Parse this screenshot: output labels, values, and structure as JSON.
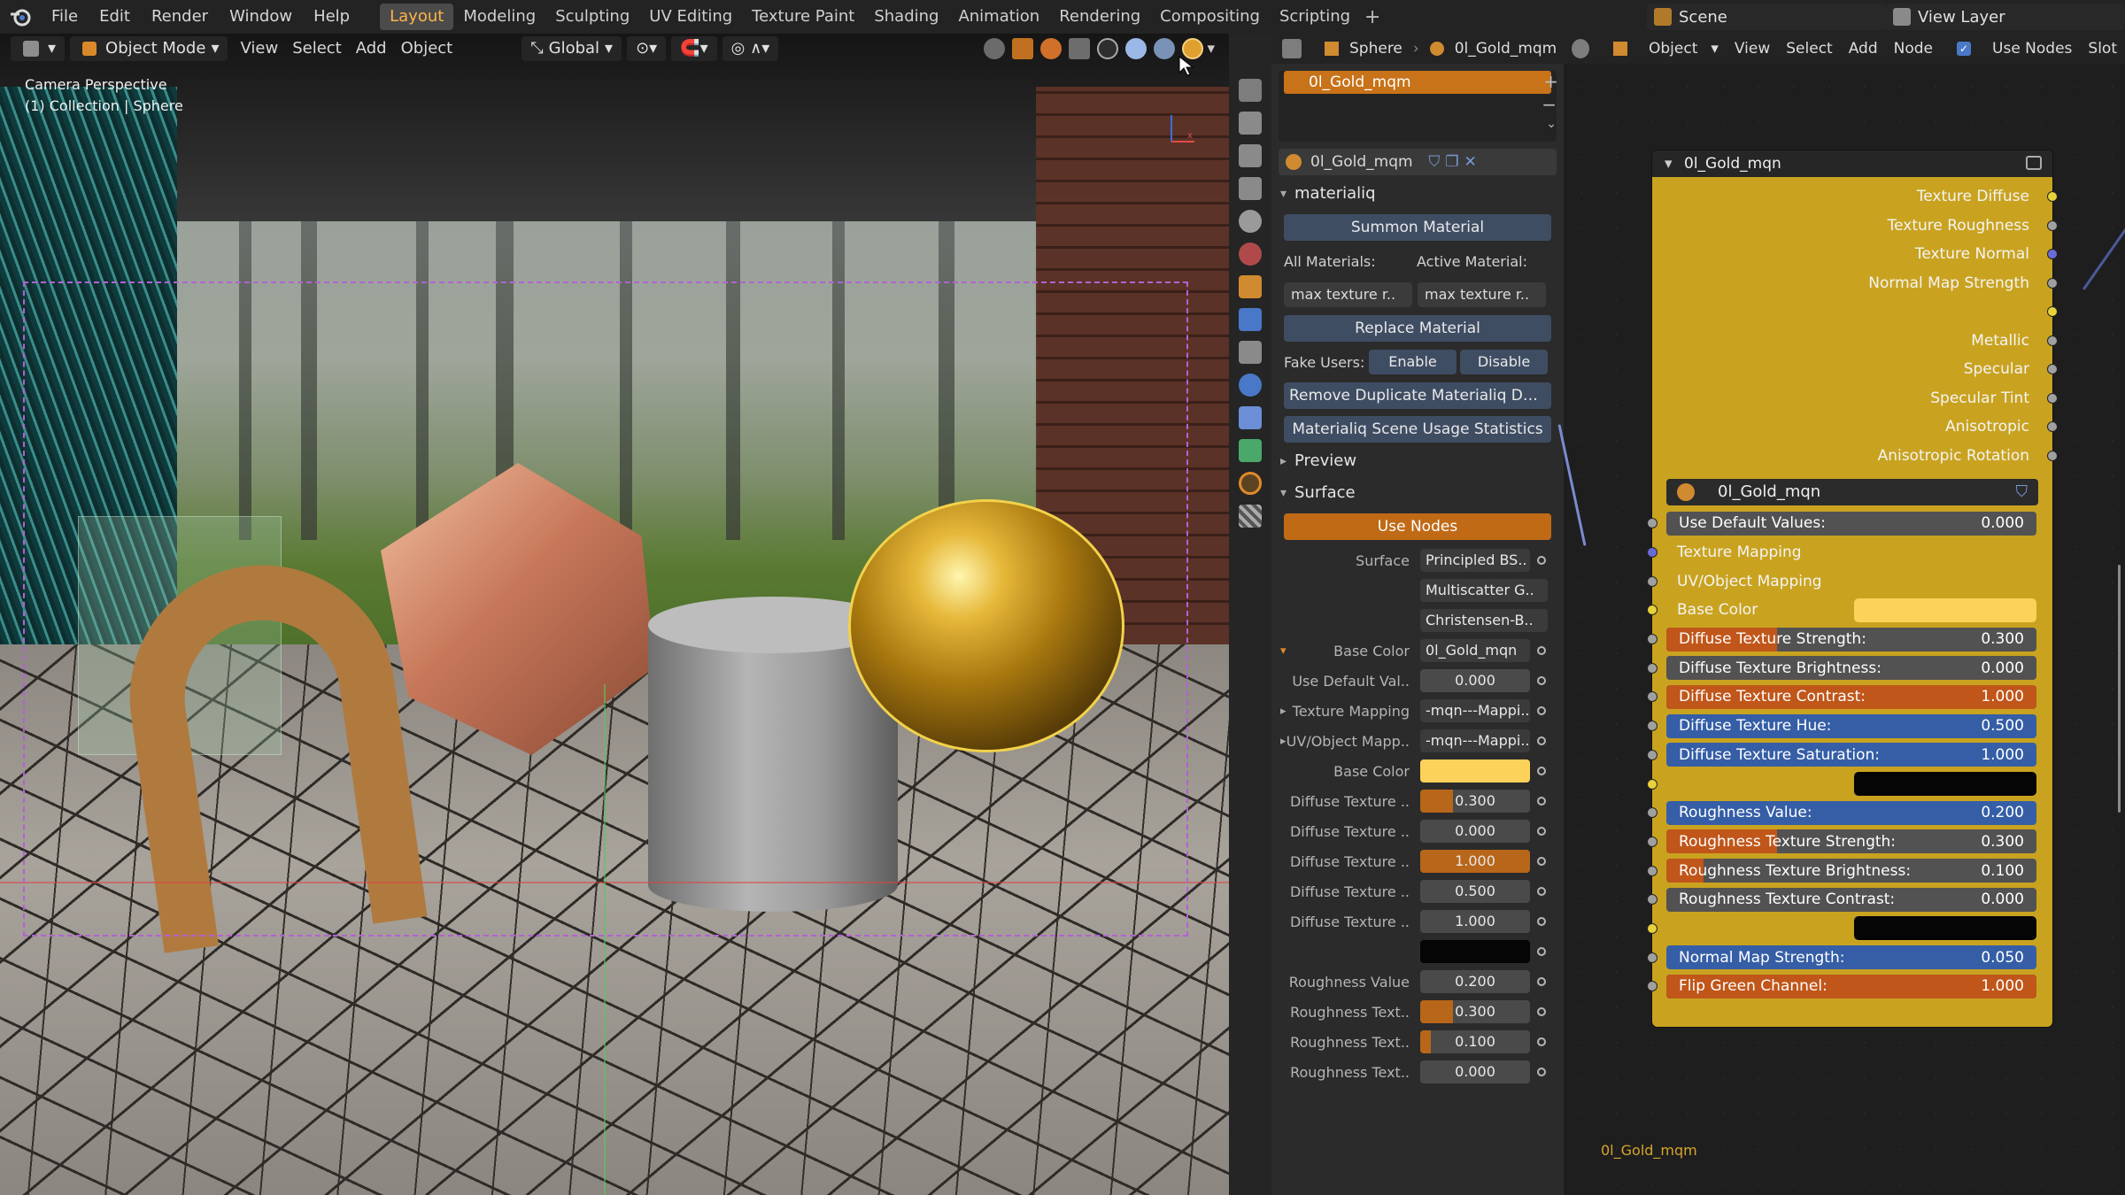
{
  "menubar": {
    "items": [
      "File",
      "Edit",
      "Render",
      "Window",
      "Help"
    ],
    "workspaces": [
      "Layout",
      "Modeling",
      "Sculpting",
      "UV Editing",
      "Texture Paint",
      "Shading",
      "Animation",
      "Rendering",
      "Compositing",
      "Scripting"
    ],
    "active_workspace": "Layout",
    "add_workspace": "+",
    "scene": "Scene",
    "view_layer": "View Layer"
  },
  "viewport": {
    "mode": "Object Mode",
    "menus": [
      "View",
      "Select",
      "Add",
      "Object"
    ],
    "transform_orientation": "Global",
    "camera_label": "Camera Perspective",
    "collection_label": "(1) Collection | Sphere"
  },
  "properties": {
    "object_name": "Sphere",
    "material_name": "0l_Gold_mqm",
    "slot_name": "0l_Gold_mqm",
    "material_field": "0l_Gold_mqm",
    "addon_section": "materialiq",
    "summon_button": "Summon Material",
    "all_materials_label": "All Materials:",
    "active_material_label": "Active Material:",
    "all_materials_value": "max texture r..",
    "active_material_value": "max texture r..",
    "replace_button": "Replace Material",
    "fake_users_label": "Fake Users:",
    "enable_button": "Enable",
    "disable_button": "Disable",
    "remove_dup_button": "Remove Duplicate Materialiq Data-..",
    "stats_button": "Materialiq Scene Usage Statistics",
    "preview_section": "Preview",
    "surface_section": "Surface",
    "use_nodes_button": "Use Nodes",
    "surface_label": "Surface",
    "surface_value": "Principled BS..",
    "subsurface_method": "Multiscatter G..",
    "distribution": "Christensen-B..",
    "fields": [
      {
        "label": "Base Color",
        "value": "0l_Gold_mqn",
        "kind": "link",
        "expander": "open"
      },
      {
        "label": "Use Default Val..",
        "value": "0.000",
        "kind": "plain"
      },
      {
        "label": "Texture Mapping",
        "value": "-mqn---Mappi..",
        "kind": "link",
        "expander": "closed"
      },
      {
        "label": "UV/Object Mapp..",
        "value": "-mqn---Mappi..",
        "kind": "link",
        "expander": "closed"
      },
      {
        "label": "Base Color",
        "value": "",
        "kind": "color",
        "color": "#fcd25a"
      },
      {
        "label": "Diffuse Texture ..",
        "value": "0.300",
        "kind": "slider",
        "fill": 0.3
      },
      {
        "label": "Diffuse Texture ..",
        "value": "0.000",
        "kind": "slider",
        "fill": 0.0
      },
      {
        "label": "Diffuse Texture ..",
        "value": "1.000",
        "kind": "slider",
        "fill": 1.0
      },
      {
        "label": "Diffuse Texture ..",
        "value": "0.500",
        "kind": "plain"
      },
      {
        "label": "Diffuse Texture ..",
        "value": "1.000",
        "kind": "plain"
      },
      {
        "label": "",
        "value": "",
        "kind": "black"
      },
      {
        "label": "Roughness Value",
        "value": "0.200",
        "kind": "plain"
      },
      {
        "label": "Roughness Text..",
        "value": "0.300",
        "kind": "slider",
        "fill": 0.3
      },
      {
        "label": "Roughness Text..",
        "value": "0.100",
        "kind": "slider",
        "fill": 0.1
      },
      {
        "label": "Roughness Text..",
        "value": "0.000",
        "kind": "slider",
        "fill": 0.0
      }
    ]
  },
  "node_editor": {
    "mode": "Object",
    "menus": [
      "View",
      "Select",
      "Add",
      "Node"
    ],
    "use_nodes_label": "Use Nodes",
    "slot_label": "Slot",
    "node_title": "0l_Gold_mqn",
    "node_group": "0l_Gold_mqn",
    "footer_label": "0l_Gold_mqm",
    "outputs": [
      {
        "label": "Texture Diffuse",
        "color": "#e8d23a"
      },
      {
        "label": "Texture Roughness",
        "color": "#a0a0a0"
      },
      {
        "label": "Texture Normal",
        "color": "#6b6bd8"
      },
      {
        "label": "Normal Map Strength",
        "color": "#a0a0a0"
      },
      {
        "label": "",
        "color": "#e8d23a"
      },
      {
        "label": "Metallic",
        "color": "#a0a0a0"
      },
      {
        "label": "Specular",
        "color": "#a0a0a0"
      },
      {
        "label": "Specular Tint",
        "color": "#a0a0a0"
      },
      {
        "label": "Anisotropic",
        "color": "#a0a0a0"
      },
      {
        "label": "Anisotropic Rotation",
        "color": "#a0a0a0"
      }
    ],
    "inputs": [
      {
        "label": "Use Default Values:",
        "value": "0.000",
        "kind": "field",
        "fill": 0,
        "sock": "#a0a0a0"
      },
      {
        "label": "Texture Mapping",
        "value": "",
        "kind": "plain",
        "sock": "#6b6bd8"
      },
      {
        "label": "UV/Object Mapping",
        "value": "",
        "kind": "plain",
        "sock": "#a0a0a0"
      },
      {
        "label": "Base Color",
        "value": "",
        "kind": "color",
        "color": "#fcd25a",
        "sock": "#e8d23a"
      },
      {
        "label": "Diffuse Texture Strength:",
        "value": "0.300",
        "kind": "field",
        "fill": 0.3,
        "sock": "#a0a0a0"
      },
      {
        "label": "Diffuse Texture Brightness:",
        "value": "0.000",
        "kind": "field",
        "fill": 0,
        "sock": "#a0a0a0"
      },
      {
        "label": "Diffuse Texture Contrast:",
        "value": "1.000",
        "kind": "field",
        "fill": 1,
        "sock": "#a0a0a0"
      },
      {
        "label": "Diffuse Texture Hue:",
        "value": "0.500",
        "kind": "blue",
        "sock": "#a0a0a0"
      },
      {
        "label": "Diffuse Texture Saturation:",
        "value": "1.000",
        "kind": "blue",
        "sock": "#a0a0a0"
      },
      {
        "label": "",
        "value": "",
        "kind": "black",
        "sock": "#e8d23a"
      },
      {
        "label": "Roughness Value:",
        "value": "0.200",
        "kind": "blue",
        "sock": "#a0a0a0"
      },
      {
        "label": "Roughness Texture Strength:",
        "value": "0.300",
        "kind": "field",
        "fill": 0.3,
        "sock": "#a0a0a0"
      },
      {
        "label": "Roughness Texture Brightness:",
        "value": "0.100",
        "kind": "field",
        "fill": 0.1,
        "sock": "#a0a0a0"
      },
      {
        "label": "Roughness Texture Contrast:",
        "value": "0.000",
        "kind": "field",
        "fill": 0,
        "sock": "#a0a0a0"
      },
      {
        "label": "",
        "value": "",
        "kind": "black",
        "sock": "#e8d23a"
      },
      {
        "label": "Normal Map Strength:",
        "value": "0.050",
        "kind": "blue",
        "sock": "#a0a0a0"
      },
      {
        "label": "Flip Green Channel:",
        "value": "1.000",
        "kind": "field",
        "fill": 1,
        "sock": "#a0a0a0"
      }
    ]
  },
  "colors": {
    "accent": "#ffb347",
    "active_orange": "#c87219",
    "node_body": "#c9a320",
    "button_blue": "#3f4d63",
    "gold_sphere_outline": "#f2d24a"
  }
}
